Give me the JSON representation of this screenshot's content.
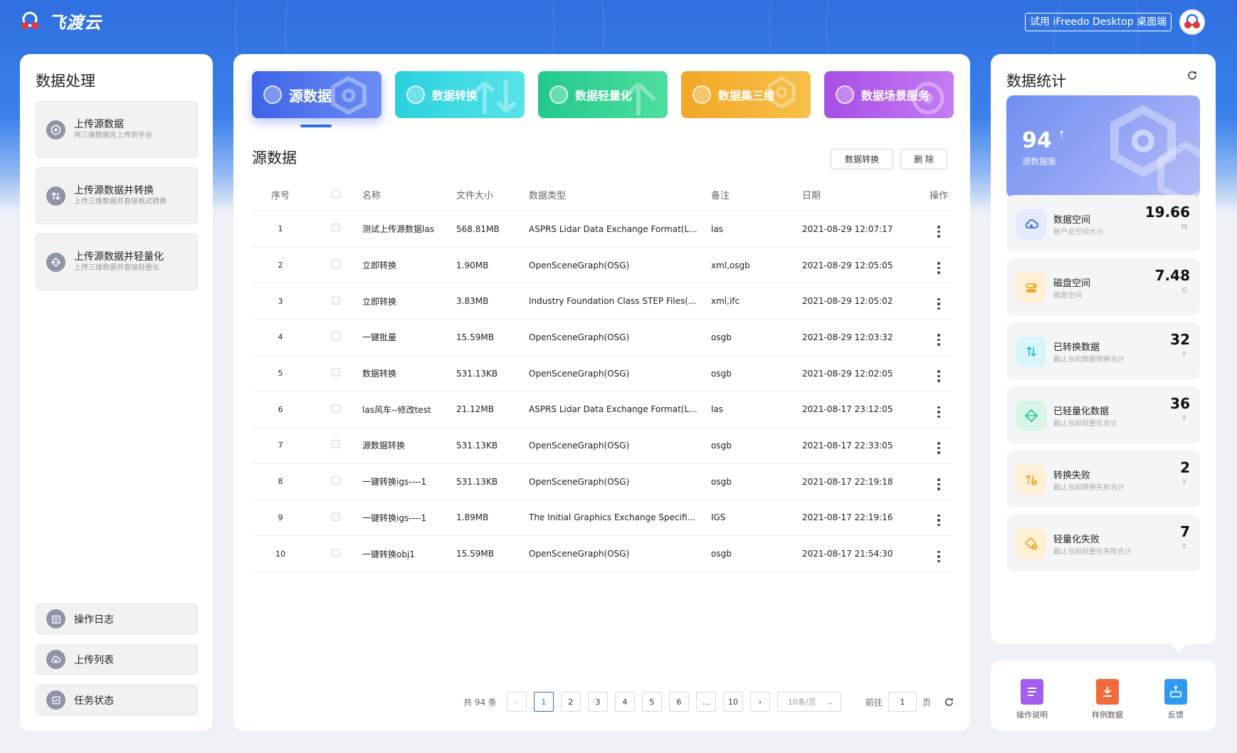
{
  "header": {
    "logo_text": "飞渡云",
    "trial_button": "试用 iFreedo Desktop 桌面端"
  },
  "left": {
    "title": "数据处理",
    "ops": [
      {
        "title": "上传源数据",
        "desc": "将三维数据先上传到平台",
        "icon": "hexagon-shield-icon"
      },
      {
        "title": "上传源数据并转换",
        "desc": "上传三维数据并直接格式转换",
        "icon": "convert-arrows-icon"
      },
      {
        "title": "上传源数据并轻量化",
        "desc": "上传三维数据并直接轻量化",
        "icon": "diamond-cube-icon"
      }
    ],
    "links": [
      {
        "label": "操作日志",
        "icon": "log-calendar-icon"
      },
      {
        "label": "上传列表",
        "icon": "cloud-upload-icon"
      },
      {
        "label": "任务状态",
        "icon": "task-check-icon"
      }
    ]
  },
  "tabs": [
    {
      "label": "源数据",
      "color1": "#3d63e8",
      "color2": "#6d8df3"
    },
    {
      "label": "数据转换",
      "color1": "#2bd1de",
      "color2": "#57e3e8"
    },
    {
      "label": "数据轻量化",
      "color1": "#22c98b",
      "color2": "#4ede9f"
    },
    {
      "label": "数据集三维",
      "color1": "#f2a726",
      "color2": "#f7c04a"
    },
    {
      "label": "数据场景服务",
      "color1": "#a64ee6",
      "color2": "#c57cf2"
    }
  ],
  "main": {
    "section_title": "源数据",
    "btn_convert": "数据转换",
    "btn_delete": "删 除",
    "columns": [
      "序号",
      "",
      "名称",
      "文件大小",
      "数据类型",
      "备注",
      "日期",
      "操作"
    ],
    "rows": [
      {
        "no": "1",
        "name": "测试上传源数据las",
        "size": "568.81MB",
        "type": "ASPRS Lidar Data Exchange Format(L...",
        "note": "las",
        "date": "2021-08-29 12:07:17"
      },
      {
        "no": "2",
        "name": "立即转换",
        "size": "1.90MB",
        "type": "OpenSceneGraph(OSG)",
        "note": "xml,osgb",
        "date": "2021-08-29 12:05:05"
      },
      {
        "no": "3",
        "name": "立即转换",
        "size": "3.83MB",
        "type": "Industry Foundation Class STEP Files(...",
        "note": "xml,ifc",
        "date": "2021-08-29 12:05:02"
      },
      {
        "no": "4",
        "name": "一键批量",
        "size": "15.59MB",
        "type": "OpenSceneGraph(OSG)",
        "note": "osgb",
        "date": "2021-08-29 12:03:32"
      },
      {
        "no": "5",
        "name": "数据转换",
        "size": "531.13KB",
        "type": "OpenSceneGraph(OSG)",
        "note": "osgb",
        "date": "2021-08-29 12:02:05"
      },
      {
        "no": "6",
        "name": "las风车--修改test",
        "size": "21.12MB",
        "type": "ASPRS Lidar Data Exchange Format(L...",
        "note": "las",
        "date": "2021-08-17 23:12:05"
      },
      {
        "no": "7",
        "name": "源数据转换",
        "size": "531.13KB",
        "type": "OpenSceneGraph(OSG)",
        "note": "osgb",
        "date": "2021-08-17 22:33:05"
      },
      {
        "no": "8",
        "name": "一键转换igs----1",
        "size": "531.13KB",
        "type": "OpenSceneGraph(OSG)",
        "note": "osgb",
        "date": "2021-08-17 22:19:18"
      },
      {
        "no": "9",
        "name": "一键转换igs----1",
        "size": "1.89MB",
        "type": "The Initial Graphics Exchange Specifi...",
        "note": "IGS",
        "date": "2021-08-17 22:19:16"
      },
      {
        "no": "10",
        "name": "一键转换obj1",
        "size": "15.59MB",
        "type": "OpenSceneGraph(OSG)",
        "note": "osgb",
        "date": "2021-08-17 21:54:30"
      }
    ],
    "pager": {
      "total": "共 94 条",
      "pages": [
        "1",
        "2",
        "3",
        "4",
        "5",
        "6",
        "...",
        "10"
      ],
      "active": "1",
      "page_size": "10条/页",
      "goto_label": "前往",
      "goto_value": "1",
      "page_suffix": "页"
    }
  },
  "right": {
    "title": "数据统计",
    "hero": {
      "value": "94",
      "arrow": "↑",
      "label": "源数据集"
    },
    "stats": [
      {
        "title": "数据空间",
        "sub": "账户总空间大小",
        "value": "19.66",
        "unit": "M",
        "icon": "cloud-data-icon",
        "bg": "#e3ebff",
        "fg": "#3d63e8"
      },
      {
        "title": "磁盘空间",
        "sub": "磁盘空间",
        "value": "7.48",
        "unit": "G",
        "icon": "disk-toggle-icon",
        "bg": "#fff0d6",
        "fg": "#f2a726"
      },
      {
        "title": "已转换数据",
        "sub": "截止当前数据转换合计",
        "value": "32",
        "unit": "↑",
        "icon": "convert-icon",
        "bg": "#d8f6fa",
        "fg": "#22b8cf"
      },
      {
        "title": "已轻量化数据",
        "sub": "截止当前轻量化合计",
        "value": "36",
        "unit": "↑",
        "icon": "lightweight-icon",
        "bg": "#d7f6e7",
        "fg": "#22c98b"
      },
      {
        "title": "转换失败",
        "sub": "截止当前转换失败合计",
        "value": "2",
        "unit": "↑",
        "icon": "convert-fail-icon",
        "bg": "#fff0d6",
        "fg": "#f2a726"
      },
      {
        "title": "轻量化失败",
        "sub": "截止当前轻量化失败合计",
        "value": "7",
        "unit": "↑",
        "icon": "lightweight-fail-icon",
        "bg": "#fff0d6",
        "fg": "#f2a726"
      }
    ]
  },
  "bottom": [
    {
      "label": "操作说明",
      "icon": "manual-icon",
      "color": "#a15ef0"
    },
    {
      "label": "样例数据",
      "icon": "sample-download-icon",
      "color": "#f26a3a"
    },
    {
      "label": "反馈",
      "icon": "feedback-inbox-icon",
      "color": "#2f9af0"
    }
  ]
}
